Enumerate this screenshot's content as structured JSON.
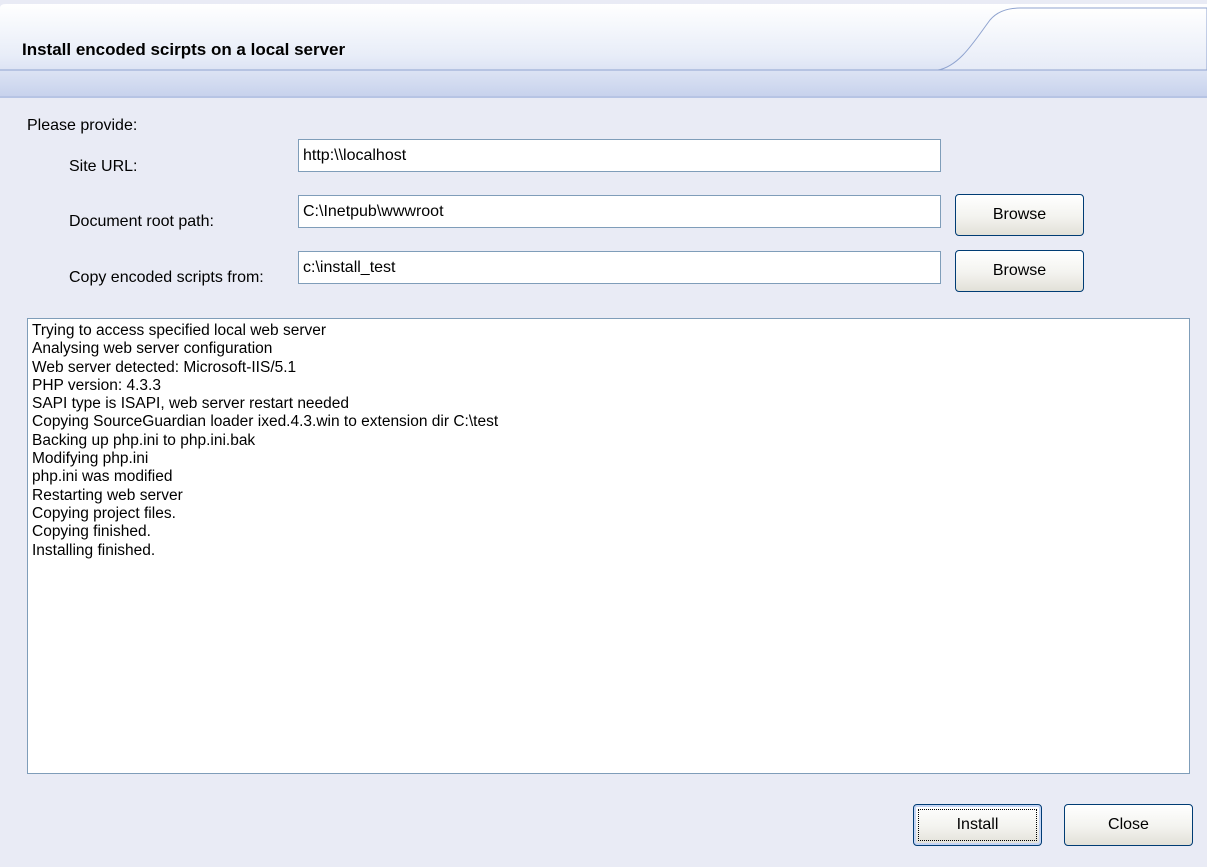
{
  "header": {
    "title": "Install encoded scirpts on a local server"
  },
  "form": {
    "intro": "Please provide:",
    "site_url": {
      "label": "Site URL:",
      "value": "http:\\\\localhost"
    },
    "doc_root": {
      "label": "Document root path:",
      "value": "C:\\Inetpub\\wwwroot",
      "browse_label": "Browse"
    },
    "copy_from": {
      "label": "Copy encoded scripts from:",
      "value": "c:\\install_test",
      "browse_label": "Browse"
    }
  },
  "log": {
    "lines": [
      "Trying to access specified local web server",
      "Analysing web server configuration",
      "Web server detected: Microsoft-IIS/5.1",
      "PHP version: 4.3.3",
      "SAPI type is ISAPI, web server restart needed",
      "Copying SourceGuardian loader ixed.4.3.win to extension dir C:\\test",
      "Backing up php.ini to php.ini.bak",
      "Modifying php.ini",
      "php.ini was modified",
      "Restarting web server",
      "Copying project files.",
      "Copying finished.",
      "Installing finished."
    ]
  },
  "footer": {
    "install_label": "Install",
    "close_label": "Close"
  },
  "colors": {
    "background": "#e9ebf5",
    "header_gradient_top": "#ffffff",
    "header_gradient_bottom": "#c9d3ec",
    "header_line": "#8fa3cf",
    "field_border": "#7f9db9",
    "button_border": "#003c74"
  }
}
